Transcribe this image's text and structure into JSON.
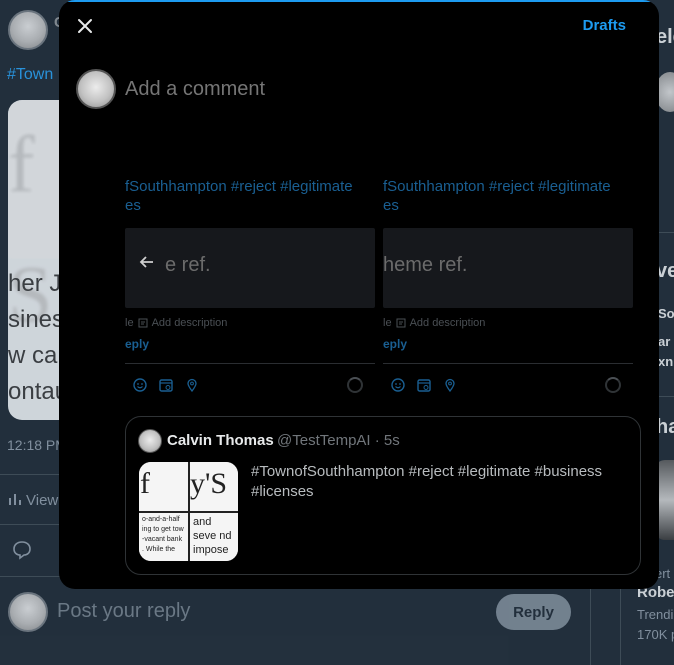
{
  "background": {
    "author_initial": "C",
    "hashtag_fragment": "#Town",
    "image_top_text": "f S",
    "image_lines": [
      "her J",
      "sines",
      "w ca",
      "ontau"
    ],
    "time": "12:18 PM",
    "views_label": "View",
    "reply_placeholder": "Post your reply",
    "reply_button": "Reply",
    "right_sidebar": {
      "title_fragment": "ele",
      "section_fragment": "ve",
      "item1": "Soi",
      "item2": "ar",
      "item3": "xn",
      "section2_fragment": "ha",
      "small_fragment": "ert",
      "name_fragment": "Robe",
      "trending": "Trendi",
      "count": "170K p"
    }
  },
  "modal": {
    "close_icon": "close-icon",
    "drafts_label": "Drafts",
    "comment_placeholder": "Add a comment",
    "ghost": {
      "tag_line_a": "fSouthhampton #reject #legitimate",
      "tag_line_a2": "es",
      "tag_line_b": "fSouthhampton #reject #legitimate",
      "tag_line_b2": "es",
      "card_a_text": "e ref.",
      "card_b_text": "heme ref.",
      "meta_a_prefix": "le",
      "meta_a": "Add description",
      "meta_b_prefix": "le",
      "meta_b": "Add description",
      "reply_a": "eply",
      "reply_b": "eply"
    },
    "quote": {
      "name": "Calvin Thomas",
      "handle_time": "@TestTempAI · 5s",
      "text": "#TownofSouthhampton #reject #legitimate #business #licenses",
      "thumb_tl": "f So",
      "thumb_tr": "y'S",
      "thumb_bl": "o-and-a-half ing to get tow -vacant bank . While the",
      "thumb_br": "and seve nd impose esses, ev"
    },
    "accent_color": "#1d9bf0"
  }
}
